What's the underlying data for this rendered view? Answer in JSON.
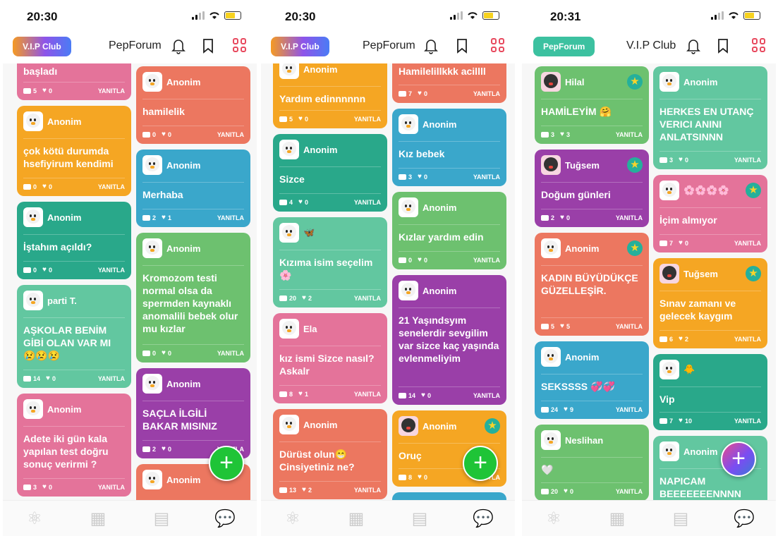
{
  "screens": [
    {
      "time": "20:30",
      "pill": "V.I.P Club",
      "title": "PepForum",
      "left": [
        {
          "name": "",
          "title": "başladı",
          "comments": "5",
          "likes": "0",
          "reply": "YANITLA"
        },
        {
          "name": "Anonim",
          "title": "çok kötü durumda hsefiyirum kendimi",
          "comments": "0",
          "likes": "0",
          "reply": "YANITLA"
        },
        {
          "name": "Anonim",
          "title": "İştahım açıldı?",
          "comments": "0",
          "likes": "0",
          "reply": "YANITLA"
        },
        {
          "name": "parti T.",
          "title": "AŞKOLAR BENİM GİBİ OLAN VAR MI 😢😢😢",
          "comments": "14",
          "likes": "0",
          "reply": "YANITLA"
        },
        {
          "name": "Anonim",
          "title": "Adete iki gün kala yapılan test doğru sonuç verirmi ?",
          "comments": "3",
          "likes": "0",
          "reply": "YANITLA"
        }
      ],
      "right": [
        {
          "name": "Anonim",
          "title": "hamilelik",
          "comments": "0",
          "likes": "0",
          "reply": "YANITLA"
        },
        {
          "name": "Anonim",
          "title": "Merhaba",
          "comments": "2",
          "likes": "1",
          "reply": "YANITLA"
        },
        {
          "name": "Anonim",
          "title": "Kromozom testi normal olsa da spermden kaynaklı anomalili bebek olur mu kızlar",
          "comments": "0",
          "likes": "0",
          "reply": "YANITLA"
        },
        {
          "name": "Anonim",
          "title": "SAÇLA İLGİLİ BAKAR MISINIZ",
          "comments": "2",
          "likes": "0",
          "reply": "YANITLA"
        },
        {
          "name": "Anonim",
          "title": "",
          "comments": "",
          "likes": "",
          "reply": ""
        }
      ]
    },
    {
      "time": "20:30",
      "pill": "V.I.P Club",
      "title": "PepForum",
      "left": [
        {
          "name": "Anonim",
          "title": "Yardım edinnnnnn",
          "comments": "5",
          "likes": "0",
          "reply": "YANITLA"
        },
        {
          "name": "Anonim",
          "title": "Sizce",
          "comments": "4",
          "likes": "0",
          "reply": "YANITLA"
        },
        {
          "name": "🦋",
          "title": "Kızıma isim seçelim 🌸",
          "comments": "20",
          "likes": "2",
          "reply": "YANITLA"
        },
        {
          "name": "Ela",
          "title": "kız ismi Sizce nasıl? Askalr",
          "comments": "8",
          "likes": "1",
          "reply": "YANITLA"
        },
        {
          "name": "Anonim",
          "title": "Dürüst olun😁 Cinsiyetiniz ne?",
          "comments": "13",
          "likes": "2",
          "reply": "YANITLA"
        }
      ],
      "right": [
        {
          "name": "",
          "title": "Hamilelillkkk acillll",
          "comments": "7",
          "likes": "0",
          "reply": "YANITLA"
        },
        {
          "name": "Anonim",
          "title": "Kız bebek",
          "comments": "3",
          "likes": "0",
          "reply": "YANITLA"
        },
        {
          "name": "Anonim",
          "title": "Kızlar yardım edin",
          "comments": "0",
          "likes": "0",
          "reply": "YANITLA"
        },
        {
          "name": "Anonim",
          "title": "21 Yaşındsyım senelerdir sevgilim var sizce kaç yaşında evlenmeliyim",
          "comments": "14",
          "likes": "0",
          "reply": "YANITLA"
        },
        {
          "name": "Anonim",
          "title": "Oruç",
          "comments": "8",
          "likes": "0",
          "reply": "YANITLA"
        }
      ]
    },
    {
      "time": "20:31",
      "pill": "PepForum",
      "title": "V.I.P Club",
      "left": [
        {
          "name": "Hilal",
          "title": "HAMİLEYİM 🤗",
          "comments": "3",
          "likes": "3",
          "reply": "YANITLA"
        },
        {
          "name": "Tuğsem",
          "title": "Doğum günleri",
          "comments": "2",
          "likes": "0",
          "reply": "YANITLA"
        },
        {
          "name": "Anonim",
          "title": "KADIN BÜYÜDÜKÇE GÜZELLEŞİR.",
          "comments": "5",
          "likes": "5",
          "reply": "YANITLA"
        },
        {
          "name": "Anonim",
          "title": "SEKSSSS 💞💞",
          "comments": "24",
          "likes": "9",
          "reply": "YANITLA"
        },
        {
          "name": "Neslihan",
          "title": "🤍",
          "comments": "20",
          "likes": "0",
          "reply": "YANITLA"
        }
      ],
      "right": [
        {
          "name": "Anonim",
          "title": "HERKES EN UTANÇ VERICI ANINI ANLATSINNN",
          "comments": "3",
          "likes": "0",
          "reply": "YANITLA"
        },
        {
          "name": "🌸🌸🌸🌸",
          "title": "İçim almıyor",
          "comments": "7",
          "likes": "0",
          "reply": "YANITLA"
        },
        {
          "name": "Tuğsem",
          "title": "Sınav zamanı ve gelecek kaygım",
          "comments": "6",
          "likes": "2",
          "reply": "YANITLA"
        },
        {
          "name": "🐥",
          "title": "Vip",
          "comments": "7",
          "likes": "10",
          "reply": "YANITLA"
        },
        {
          "name": "Anonim",
          "title": "NAPICAM BEEEEEEENNNN",
          "comments": "",
          "likes": "",
          "reply": ""
        }
      ]
    }
  ],
  "colors": {
    "pink": "#e4739a",
    "orange": "#f5a623",
    "teal": "#29a88a",
    "green": "#6dc16f",
    "mint": "#62c7a0",
    "red": "#ec7760",
    "blue": "#3aa7cb",
    "purple": "#9a3fa8",
    "fab": "#1fc437",
    "accent": "#e84a5f"
  },
  "tabs": [
    "atom-icon",
    "calendar-icon",
    "news-icon",
    "chat-icon"
  ]
}
